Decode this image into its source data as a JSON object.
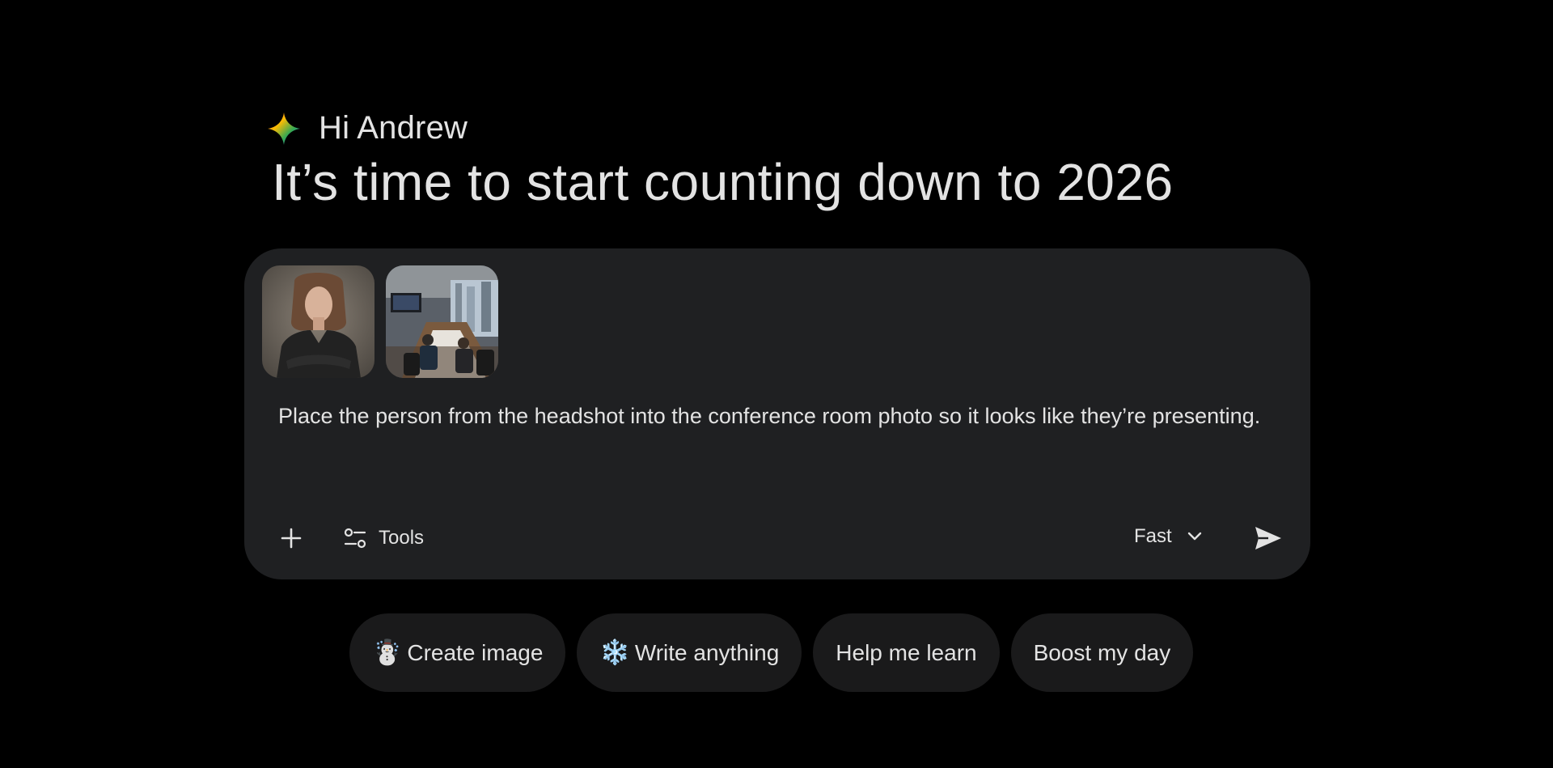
{
  "greeting": {
    "name_line": "Hi Andrew",
    "headline": "It’s time to start counting down to 2026",
    "logo_icon": "gemini-sparkle-icon"
  },
  "prompt": {
    "attachments": [
      {
        "kind": "image",
        "label": "headshot"
      },
      {
        "kind": "image",
        "label": "conference room photo"
      }
    ],
    "text": "Place the person from the headshot into the conference room photo so it looks like they’re presenting.",
    "toolbar": {
      "add_icon": "plus-icon",
      "tools_label": "Tools",
      "tools_icon": "tune-icon",
      "mode_label": "Fast",
      "mode_icon": "chevron-down-icon",
      "send_icon": "send-icon"
    }
  },
  "chips": [
    {
      "emoji": "☃️",
      "label": "Create image"
    },
    {
      "emoji": "❄️",
      "label": "Write anything"
    },
    {
      "emoji": "",
      "label": "Help me learn"
    },
    {
      "emoji": "",
      "label": "Boost my day"
    }
  ],
  "colors": {
    "background": "#000000",
    "card": "#1f2022",
    "chip": "#1a1a1b",
    "text": "#e3e3e3"
  }
}
